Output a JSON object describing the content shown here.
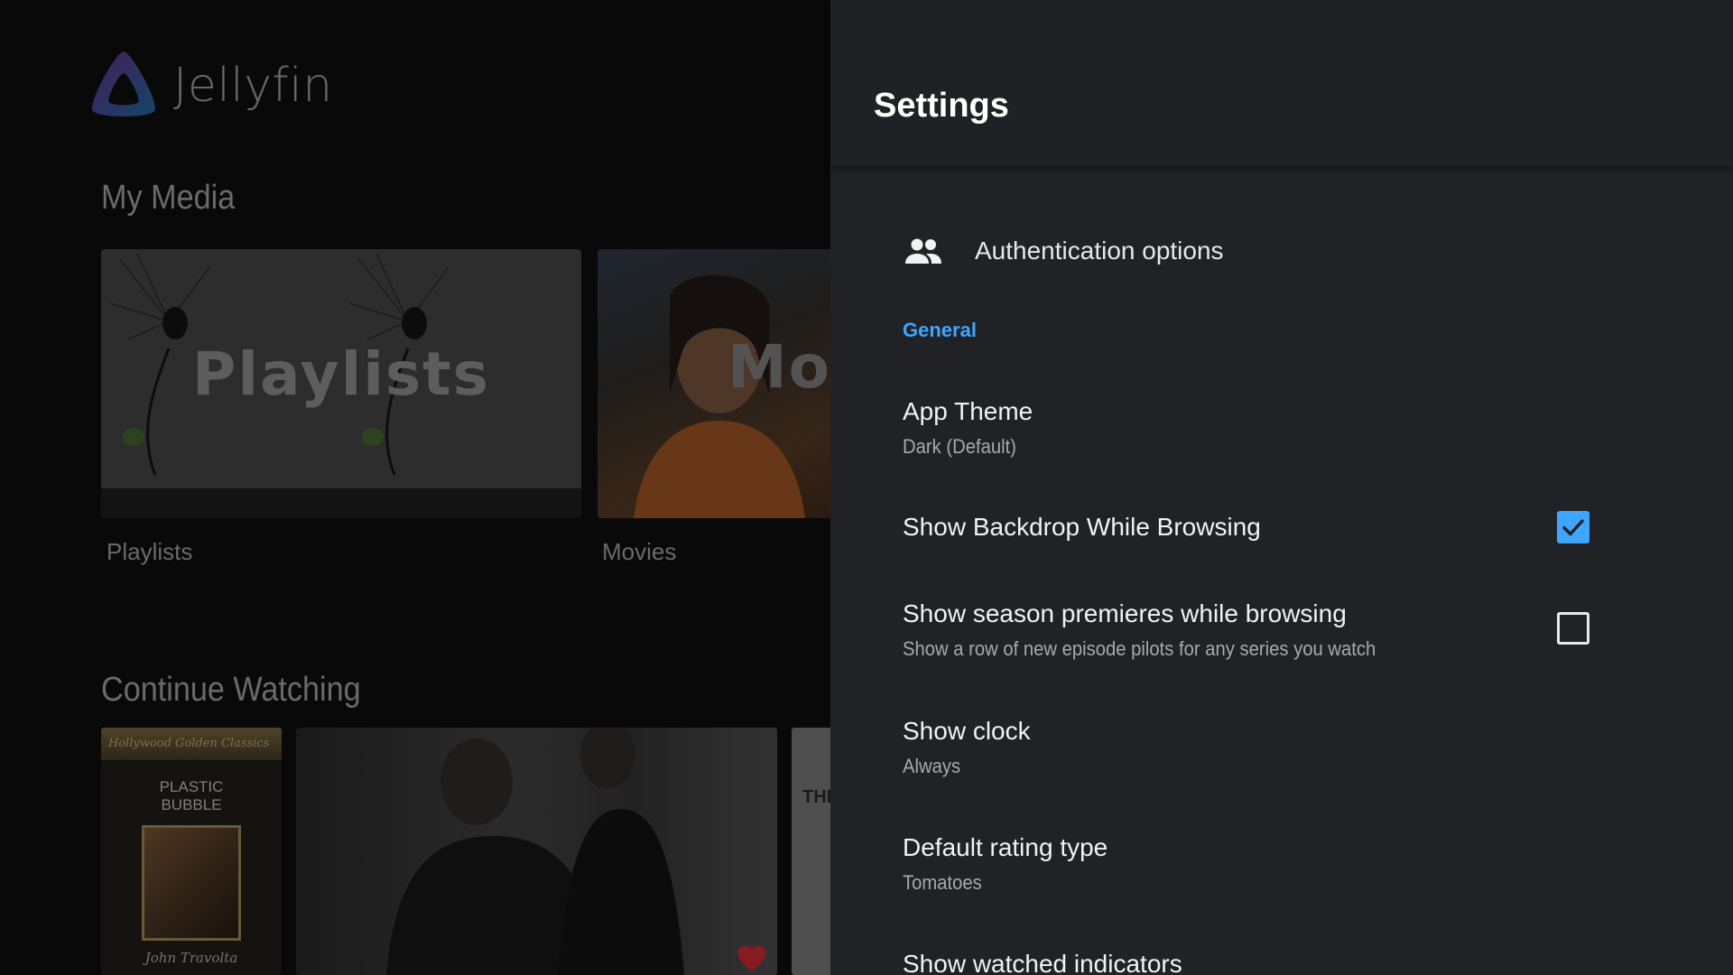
{
  "app": {
    "logo_text": "Jellyfin"
  },
  "home": {
    "my_media_title": "My Media",
    "media_tiles": [
      {
        "art_text": "Playlists",
        "label": "Playlists"
      },
      {
        "art_text": "Mov",
        "label": "Movies"
      }
    ],
    "continue_watching_title": "Continue Watching",
    "continue_watching": [
      {
        "poster_top": "Hollywood Golden Classics",
        "poster_title_line1": "PLASTIC",
        "poster_title_line2": "BUBBLE",
        "signature": "John Travolta"
      },
      {
        "favorite": true
      },
      {
        "poster_text": "THE"
      }
    ]
  },
  "settings": {
    "title": "Settings",
    "auth_label": "Authentication options",
    "section_general": "General",
    "app_theme": {
      "title": "App Theme",
      "value": "Dark (Default)"
    },
    "show_backdrop": {
      "title": "Show Backdrop While Browsing",
      "checked": true
    },
    "season_premieres": {
      "title": "Show season premieres while browsing",
      "subtitle": "Show a row of new episode pilots for any series you watch",
      "checked": false
    },
    "show_clock": {
      "title": "Show clock",
      "value": "Always"
    },
    "rating_type": {
      "title": "Default rating type",
      "value": "Tomatoes"
    },
    "watched_indicators": {
      "title": "Show watched indicators"
    }
  },
  "colors": {
    "accent": "#3ea6ff",
    "panel_bg": "#212226",
    "favorite": "#b3262c"
  }
}
